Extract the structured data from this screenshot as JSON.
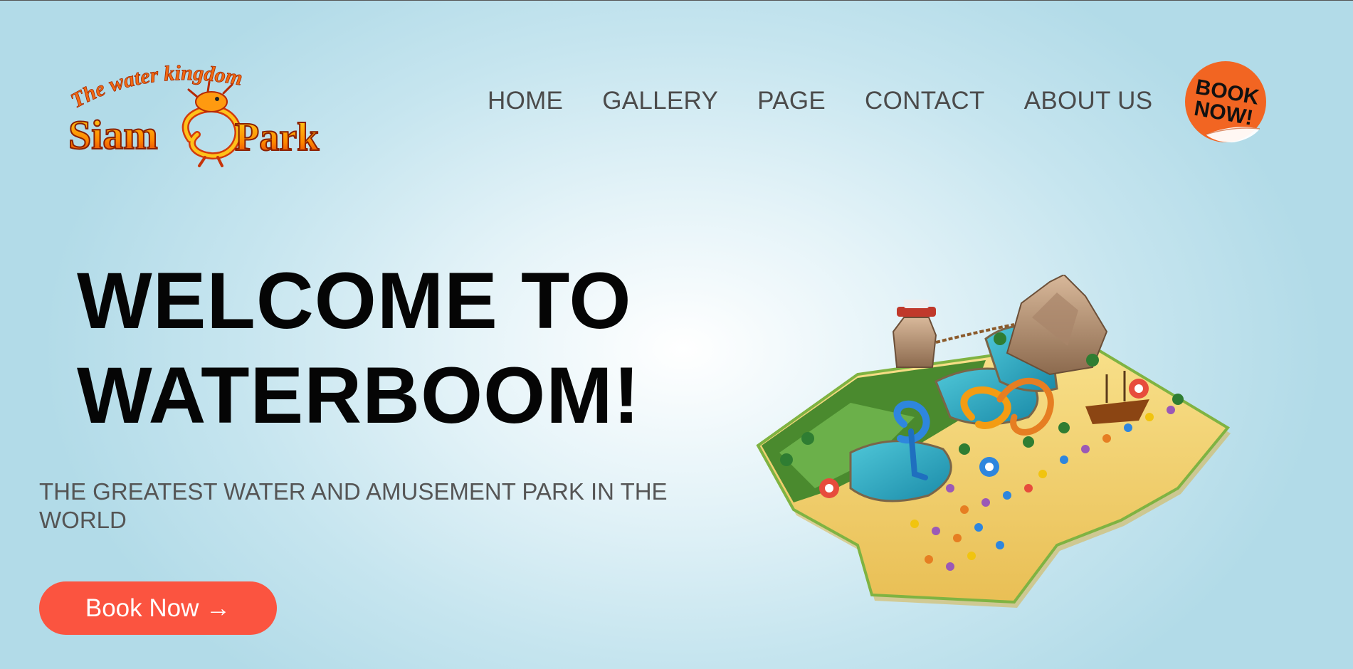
{
  "logo": {
    "tagline": "The water kingdom",
    "name": "Siam Park"
  },
  "nav": {
    "items": [
      {
        "label": "HOME"
      },
      {
        "label": "GALLERY"
      },
      {
        "label": "PAGE"
      },
      {
        "label": "CONTACT"
      },
      {
        "label": "ABOUT US"
      }
    ]
  },
  "badge": {
    "line1": "BOOK",
    "line2": "NOW!"
  },
  "hero": {
    "title_line1": "WELCOME TO",
    "title_line2": "WATERBOOM!",
    "subtitle": "THE GREATEST WATER AND AMUSEMENT PARK IN THE WORLD",
    "cta_label": "Book Now →"
  },
  "colors": {
    "accent": "#fb5440",
    "badge": "#f26522",
    "nav_text": "#4b4b4b",
    "title": "#050505",
    "background": "#c6e5ef"
  },
  "icons": {
    "logo": "siam-park-dragon-logo",
    "illustration": "water-park-island-illustration"
  }
}
